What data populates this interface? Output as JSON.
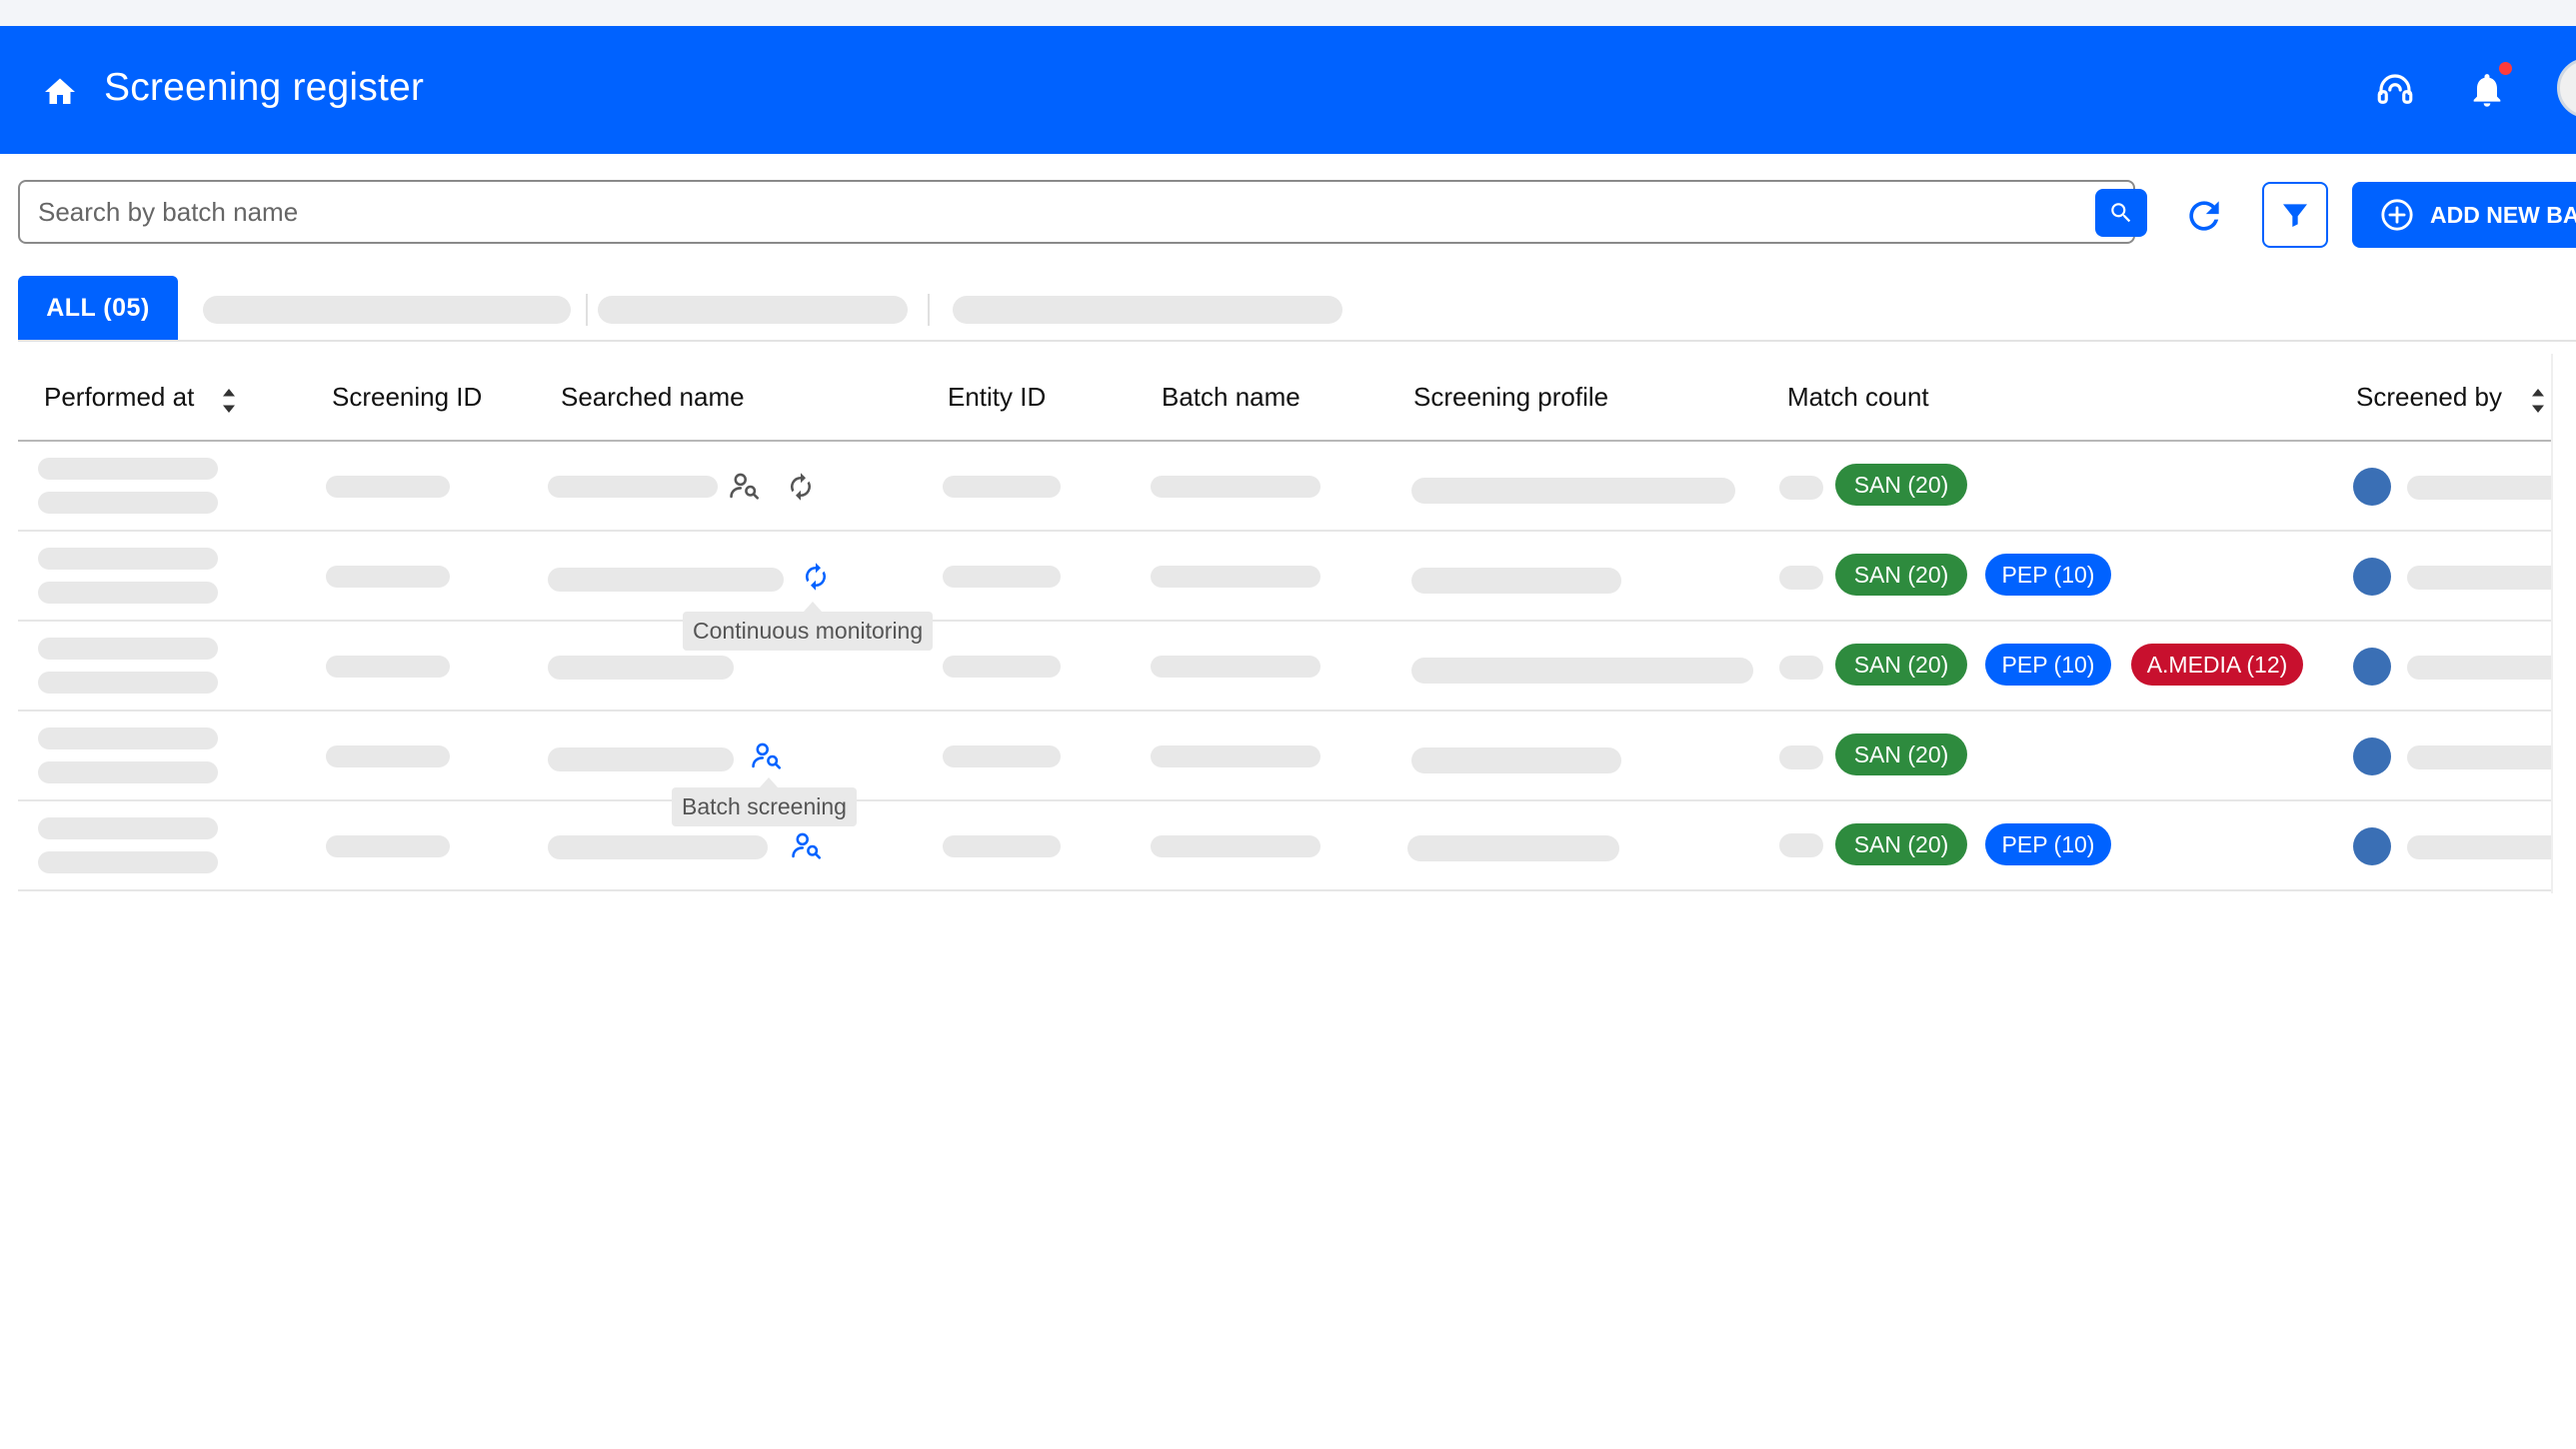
{
  "header": {
    "title": "Screening register",
    "icons": {
      "home": "home-icon",
      "support": "headset-icon",
      "notifications": "bell-icon",
      "avatar": "avatar"
    },
    "notification_dot_color": "#ff3b3b",
    "brand_color": "#0062ff"
  },
  "toolbar": {
    "search_placeholder": "Search by batch name",
    "search_value": "",
    "add_button_label": "ADD NEW BATCH",
    "icons": {
      "search": "search-icon",
      "refresh": "refresh-icon",
      "filter": "filter-icon",
      "add": "plus-circle-icon"
    }
  },
  "tabs": {
    "active_label": "ALL (05)"
  },
  "table": {
    "columns": [
      "Performed at",
      "Screening ID",
      "Searched name",
      "Entity ID",
      "Batch name",
      "Screening profile",
      "Match count",
      "Screened by"
    ],
    "sortable_columns": [
      "Performed at",
      "Screened by"
    ],
    "rows": [
      {
        "badges": [
          {
            "type": "san",
            "label": "SAN (20)"
          }
        ],
        "name_icons": [
          "batch-screening-icon",
          "continuous-monitoring-icon"
        ]
      },
      {
        "badges": [
          {
            "type": "san",
            "label": "SAN (20)"
          },
          {
            "type": "pep",
            "label": "PEP (10)"
          }
        ],
        "name_icons": [
          "continuous-monitoring-icon"
        ]
      },
      {
        "badges": [
          {
            "type": "san",
            "label": "SAN (20)"
          },
          {
            "type": "pep",
            "label": "PEP (10)"
          },
          {
            "type": "media",
            "label": "A.MEDIA (12)"
          }
        ],
        "name_icons": []
      },
      {
        "badges": [
          {
            "type": "san",
            "label": "SAN (20)"
          }
        ],
        "name_icons": [
          "batch-screening-icon"
        ]
      },
      {
        "badges": [
          {
            "type": "san",
            "label": "SAN (20)"
          },
          {
            "type": "pep",
            "label": "PEP (10)"
          }
        ],
        "name_icons": [
          "batch-screening-icon"
        ]
      }
    ],
    "badge_colors": {
      "san": "#2e8b3e",
      "pep": "#0062ff",
      "media": "#c8102e"
    }
  },
  "tooltips": {
    "continuous_monitoring": "Continuous monitoring",
    "batch_screening": "Batch screening"
  }
}
